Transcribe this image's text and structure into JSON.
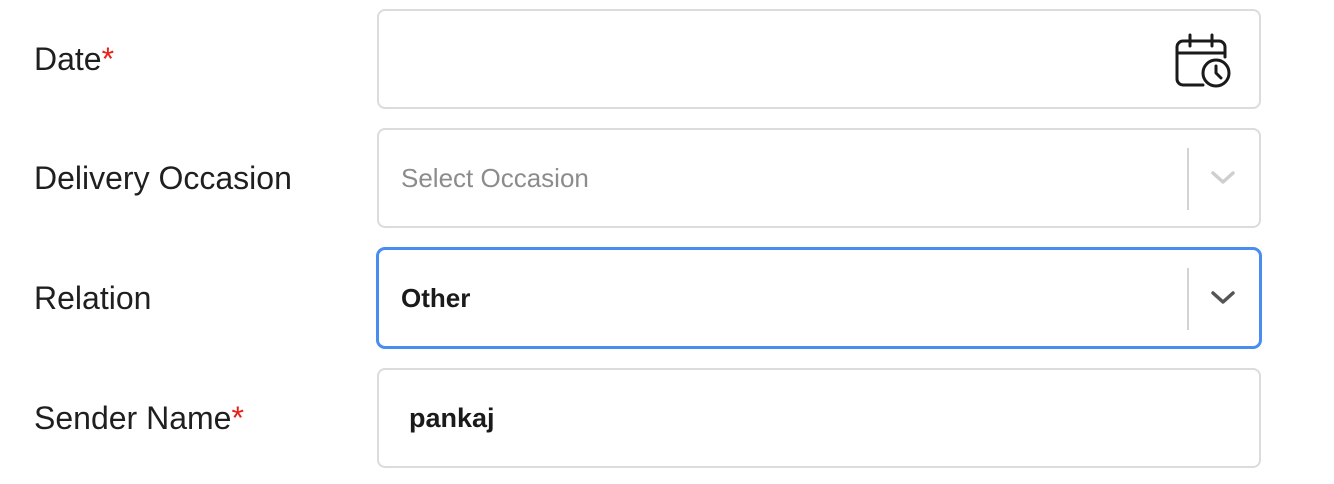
{
  "form": {
    "date": {
      "label": "Date",
      "required_marker": "*",
      "value": "",
      "icon": "calendar-clock-icon"
    },
    "delivery_occasion": {
      "label": "Delivery Occasion",
      "placeholder": "Select Occasion",
      "icon": "chevron-down-icon"
    },
    "relation": {
      "label": "Relation",
      "value": "Other",
      "icon": "chevron-down-icon"
    },
    "sender_name": {
      "label": "Sender Name",
      "required_marker": "*",
      "value": "pankaj"
    }
  },
  "colors": {
    "required": "#e8201a",
    "focus_border": "#4a8df0",
    "field_border": "#dcdcdc",
    "placeholder": "#8c8c8c"
  }
}
